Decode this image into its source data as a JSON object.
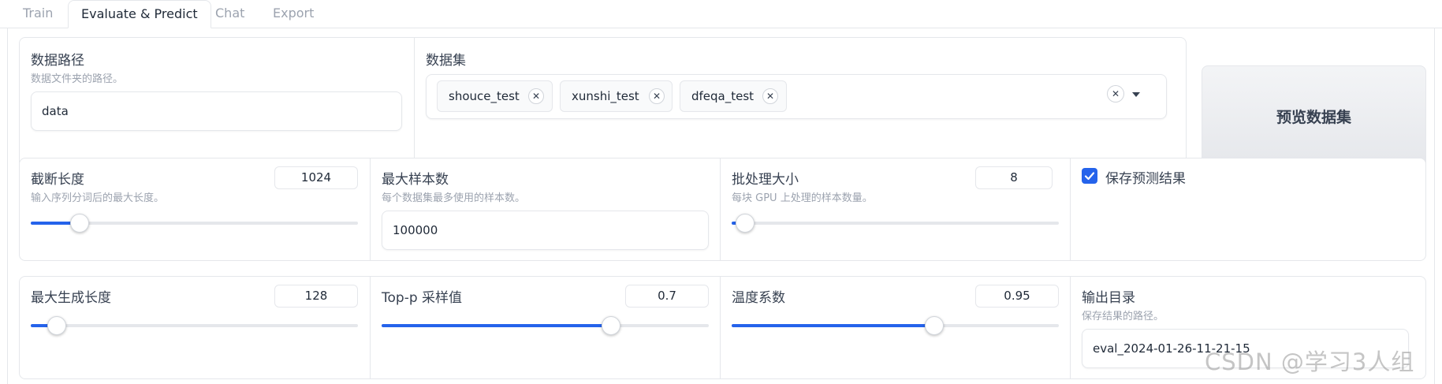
{
  "tabs": [
    {
      "label": "Train"
    },
    {
      "label": "Evaluate & Predict"
    },
    {
      "label": "Chat"
    },
    {
      "label": "Export"
    }
  ],
  "dataset_row": {
    "dataset_dir": {
      "label": "数据路径",
      "info": "数据文件夹的路径。",
      "value": "data"
    },
    "dataset": {
      "label": "数据集",
      "selected": [
        "shouce_test",
        "xunshi_test",
        "dfeqa_test"
      ]
    },
    "preview_button": "预览数据集"
  },
  "row2": {
    "cutoff_len": {
      "label": "截断长度",
      "info": "输入序列分词后的最大长度。",
      "value": "1024",
      "slider_fraction": 0.15
    },
    "max_samples": {
      "label": "最大样本数",
      "info": "每个数据集最多使用的样本数。",
      "value": "100000"
    },
    "batch_size": {
      "label": "批处理大小",
      "info": "每块 GPU 上处理的样本数量。",
      "value": "8",
      "slider_fraction": 0.04
    },
    "predict": {
      "label": "保存预测结果",
      "checked": true
    }
  },
  "row3": {
    "max_new_tokens": {
      "label": "最大生成长度",
      "value": "128",
      "slider_fraction": 0.08
    },
    "top_p": {
      "label": "Top-p 采样值",
      "value": "0.7",
      "slider_fraction": 0.7
    },
    "temperature": {
      "label": "温度系数",
      "value": "0.95",
      "slider_fraction": 0.62
    },
    "output_dir": {
      "label": "输出目录",
      "info": "保存结果的路径。",
      "value": "eval_2024-01-26-11-21-15"
    }
  },
  "watermark": "CSDN @学习3人组",
  "colors": {
    "accent": "#2563eb",
    "border": "#e5e7eb",
    "muted": "#9ca3af"
  }
}
